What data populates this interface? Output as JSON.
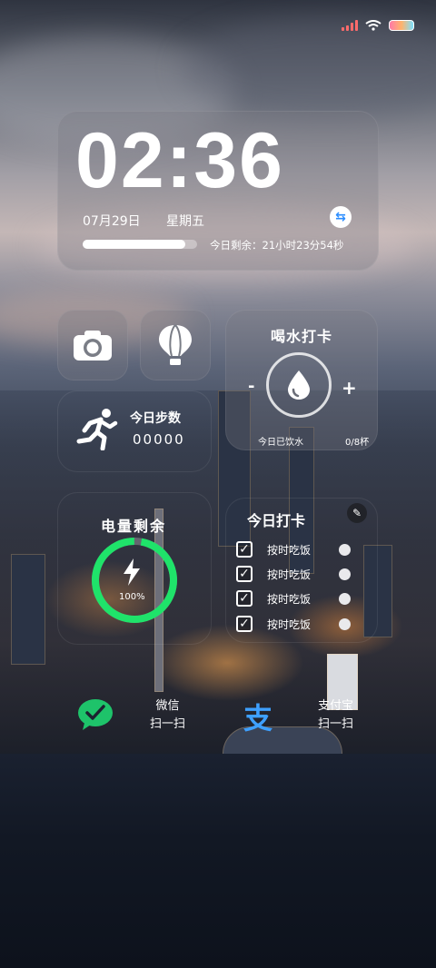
{
  "clock": {
    "time": "02:36",
    "date": "07月29日",
    "weekday": "星期五",
    "day_progress_percent": 90,
    "remaining": "今日剩余：21小时23分54秒"
  },
  "drink": {
    "title": "喝水打卡",
    "minus": "-",
    "plus": "+",
    "caption": "今日已饮水",
    "count": "0/8杯"
  },
  "steps": {
    "label": "今日步数",
    "value": "00000"
  },
  "battery": {
    "title": "电量剩余",
    "percent": "100%",
    "level_fraction": 0.97,
    "ring_color": "#1fe36a"
  },
  "checkin": {
    "title": "今日打卡",
    "tasks": [
      {
        "label": "按时吃饭",
        "mark": "✓"
      },
      {
        "label": "按时吃饭",
        "mark": "✓"
      },
      {
        "label": "按时吃饭",
        "mark": "✓"
      },
      {
        "label": "按时吃饭",
        "mark": "✓"
      }
    ]
  },
  "shortcuts": {
    "wechat": {
      "name": "微信",
      "action": "扫一扫",
      "color": "#1ec36a"
    },
    "alipay": {
      "name": "支付宝",
      "action": "扫一扫",
      "glyph": "支",
      "color": "#3ea0ff"
    }
  },
  "icons": [
    "signal-icon",
    "wifi-icon",
    "battery-icon",
    "sync-icon",
    "camera-icon",
    "balloon-icon",
    "water-drop-icon",
    "runner-icon",
    "bolt-icon",
    "edit-icon",
    "check-icon",
    "wechat-icon",
    "alipay-icon"
  ]
}
